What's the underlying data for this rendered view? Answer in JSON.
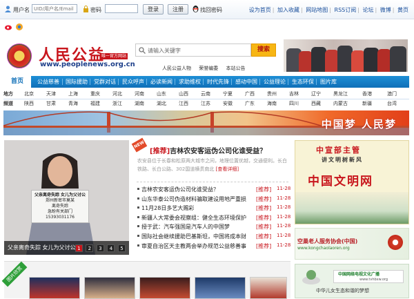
{
  "topbar": {
    "username_label": "用户名",
    "username_placeholder": "UID/用户名/Email",
    "password_label": "密码",
    "login_button": "登录",
    "register_button": "注册",
    "forgot_password": "找回密码",
    "links": [
      "设为首页",
      "加入收藏",
      "网站地图",
      "RSS订阅",
      "论坛",
      "微博",
      "黄页"
    ]
  },
  "header": {
    "site_name": "人民公益",
    "official_tag": "唯一官方网站",
    "site_url": "www.peoplenews.org.cn",
    "search_placeholder": "请输入关键字",
    "search_button": "搜索",
    "sub_tags": [
      "人民公益人物",
      "荣誉编委",
      "本站公告"
    ]
  },
  "nav": {
    "home": "首页",
    "items": [
      "公益慈善",
      "国际援助",
      "党群对话",
      "民众呼声",
      "必读新闻",
      "求助维权",
      "时代先锋",
      "感动中国",
      "公益理论",
      "生态环保",
      "图片库"
    ]
  },
  "regions": {
    "row1_label": "地方",
    "row1": [
      "北京",
      "天津",
      "上海",
      "重庆",
      "河北",
      "河南",
      "山东",
      "山西",
      "云南",
      "宁夏",
      "广西",
      "贵州",
      "吉林",
      "辽宁",
      "黑龙江",
      "香港",
      "澳门"
    ],
    "row2_label": "频道",
    "row2": [
      "陕西",
      "甘肃",
      "青海",
      "福建",
      "浙江",
      "湖南",
      "湖北",
      "江西",
      "江苏",
      "安徽",
      "广东",
      "海南",
      "四川",
      "西藏",
      "内蒙古",
      "新疆",
      "台湾"
    ]
  },
  "banner": {
    "slogan": "中国梦  人民梦"
  },
  "slideshow": {
    "caption": "父亲离奇失踪  女儿为父讨公",
    "pages": [
      "1",
      "2",
      "3",
      "4",
      "5"
    ],
    "active_page": 1,
    "sign_lines": [
      "父亲离奇失踪 女儿为父讨公",
      "郑州新密市莫某",
      "离奇失踪",
      "急盼有关部门",
      "15393031176"
    ]
  },
  "feature": {
    "tag": "[推荐]",
    "title": "吉林农安客运伪公司化谁受益？",
    "body": "农安县位于长春和松原两大城市之间，地理位置优越，交通便利。长白铁路、长白公路、302国道横贯南北",
    "more": "[查看详细]",
    "new_badge": "NEW"
  },
  "news": [
    {
      "title": "吉林农安客运伪公司化谁受益？",
      "tag": "[推荐]",
      "date": "11-28"
    },
    {
      "title": "山东华泰公司伪造材料骗取建设用地严重损",
      "tag": "[推荐]",
      "date": "11-28"
    },
    {
      "title": "11月28日多艺大赐彩",
      "tag": "[推荐]",
      "date": "11-28"
    },
    {
      "title": "新疆人大常委会视察组：健全生态环境保护",
      "tag": "[推荐]",
      "date": "11-28"
    },
    {
      "title": "授于武：汽车强国是汽车人的中国梦",
      "tag": "[推荐]",
      "date": "11-28"
    },
    {
      "title": "国际社会继续援助巴基斯坦，中国将成本财",
      "tag": "[推荐]",
      "date": "11-28"
    },
    {
      "title": "审夏自治区天主教两会举办规范公益慈善事",
      "tag": "[推荐]",
      "date": "11-28"
    }
  ],
  "ads": {
    "ad1_line1": "中宣部主管",
    "ad1_line2": "讲文明树新风",
    "ad1_line3": "中国文明网",
    "ad2_line1": "空巢老人服务协会(中国)",
    "ad2_line2": "www.kongchaolaoren.org",
    "ad3_line1": "中国网络电视文化广播",
    "ad3_line2": "www.tvhbxw.org",
    "ad3_line3": "中华儿女生态和谐的梦想"
  },
  "thumbs": {
    "ribbon": "图片欣赏"
  }
}
